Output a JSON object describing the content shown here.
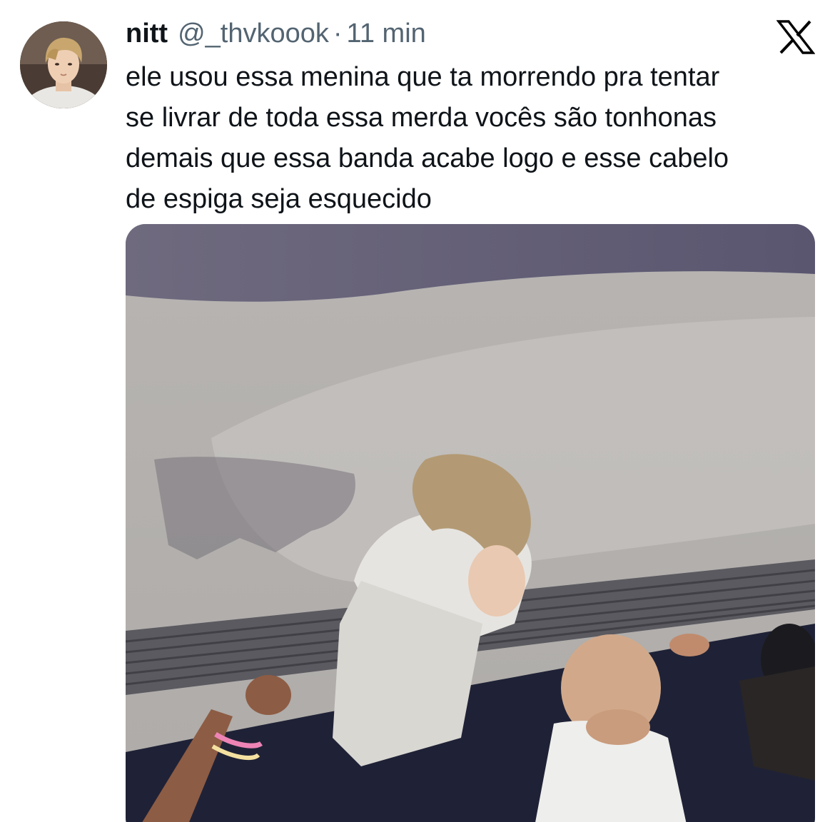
{
  "tweet": {
    "avatar_icon": "profile-photo",
    "display_name": "nitt",
    "handle": "@_thvkoook",
    "separator": "·",
    "time": "11 min",
    "platform_icon": "x-logo-icon",
    "text": "ele usou essa menina que ta morrendo pra tentar\nse livrar de toda essa merda vocês são tonhonas\ndemais que essa banda acabe logo e esse cabelo\nde espiga seja esquecido",
    "media": {
      "type": "photo"
    }
  },
  "colors": {
    "text_primary": "#0f1419",
    "text_secondary": "#536471",
    "background": "#ffffff"
  }
}
